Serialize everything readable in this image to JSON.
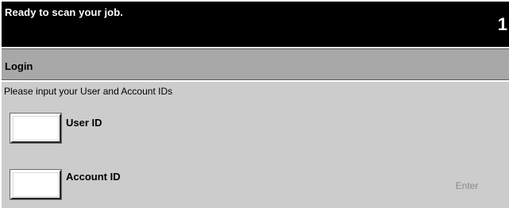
{
  "status": {
    "message": "Ready to scan your job.",
    "job_count": "1"
  },
  "title": "Login",
  "instruction": "Please input your User and Account IDs",
  "fields": [
    {
      "label": "User ID",
      "value": ""
    },
    {
      "label": "Account ID",
      "value": ""
    }
  ],
  "enter_label": "Enter",
  "colors": {
    "status_bar": "#000000",
    "title_bar": "#a8a8a8",
    "panel": "#cccccc",
    "disabled_text": "#8a8a8a"
  }
}
